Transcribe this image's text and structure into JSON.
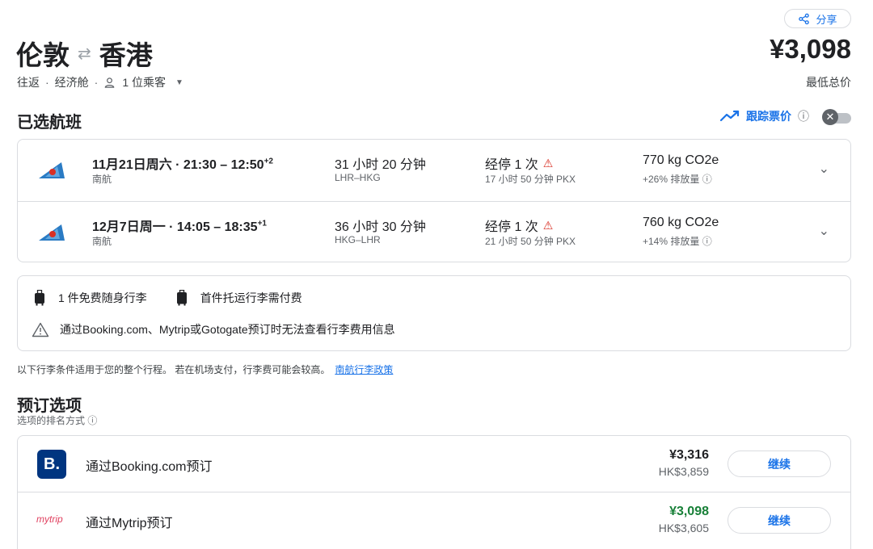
{
  "share": {
    "label": "分享"
  },
  "header": {
    "origin": "伦敦",
    "destination": "香港",
    "swap_glyph": "⇄",
    "price": "¥3,098",
    "price_caption": "最低总价",
    "trip_type": "往返",
    "cabin": "经济舱",
    "passengers": "1 位乘客"
  },
  "selected": {
    "title": "已选航班",
    "track_label": "跟踪票价",
    "toggle_on": false
  },
  "flights": [
    {
      "time": "11月21日周六 · 21:30 – 12:50",
      "day_offset": "+2",
      "airline": "南航",
      "duration": "31 小时 20 分钟",
      "route": "LHR–HKG",
      "stops": "经停 1 次",
      "layover": "17 小时 50 分钟 PKX",
      "co2": "770 kg CO2e",
      "emissions": "+26% 排放量"
    },
    {
      "time": "12月7日周一 · 14:05 – 18:35",
      "day_offset": "+1",
      "airline": "南航",
      "duration": "36 小时 30 分钟",
      "route": "HKG–LHR",
      "stops": "经停 1 次",
      "layover": "21 小时 50 分钟 PKX",
      "co2": "760 kg CO2e",
      "emissions": "+14% 排放量"
    }
  ],
  "baggage": {
    "carry_on": "1 件免费随身行李",
    "checked": "首件托运行李需付费",
    "warning": "通过Booking.com、Mytrip或Gotogate预订时无法查看行李费用信息",
    "note": "以下行李条件适用于您的整个行程。 若在机场支付，行李费可能会较高。",
    "policy_link": "南航行李政策"
  },
  "booking": {
    "title": "预订选项",
    "sort_label": "选项的排名方式",
    "options": [
      {
        "logo": "B.",
        "label": "通过Booking.com预订",
        "price": "¥3,316",
        "hk_price": "HK$3,859",
        "button": "继续"
      },
      {
        "logo": "mytrip",
        "label": "通过Mytrip预订",
        "price": "¥3,098",
        "hk_price": "HK$3,605",
        "button": "继续"
      }
    ]
  },
  "icons": {
    "info": "ⓘ",
    "chevron": "⌄",
    "warning_red": "⚠",
    "close": "✕"
  },
  "colors": {
    "accent": "#1a73e8",
    "warning": "#d93025",
    "best_price": "#188038",
    "booking_brand": "#003580",
    "mytrip_brand": "#e0405f"
  }
}
